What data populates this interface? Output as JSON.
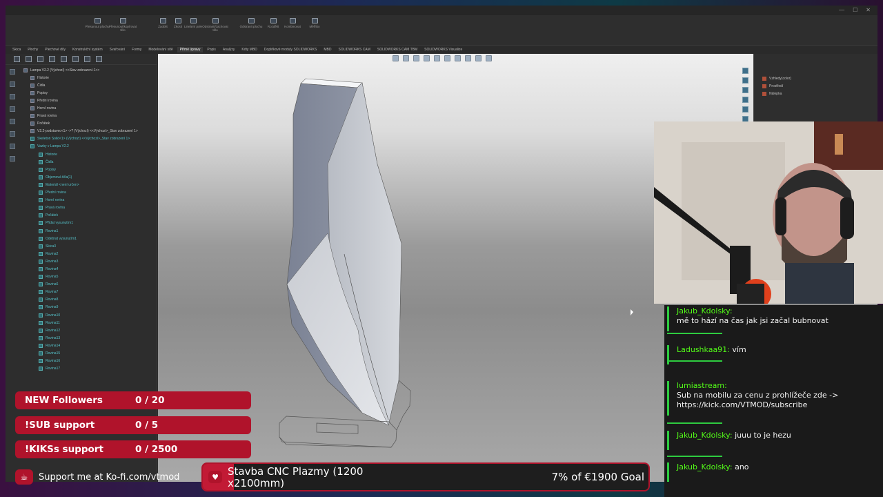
{
  "colors": {
    "accent": "#b0132b",
    "chat_name": "#53fc18",
    "chat_bar": "#2ecc40"
  },
  "ribbon": {
    "buttons": [
      {
        "label": "Přesunout plochu",
        "icon": "move-face-icon"
      },
      {
        "label": "Přesunout/kopírovat tělo",
        "icon": "move-body-icon"
      },
      {
        "label": "Zaoblit",
        "icon": "fillet-icon"
      },
      {
        "label": "Zkosit",
        "icon": "chamfer-icon"
      },
      {
        "label": "Lineární pole",
        "icon": "pattern-icon"
      },
      {
        "label": "Odstranit/zachovat tělo",
        "icon": "delete-body-icon"
      },
      {
        "label": "Odstranit plochu",
        "icon": "delete-face-icon"
      },
      {
        "label": "Rozdělit",
        "icon": "split-icon"
      },
      {
        "label": "Kombinovat",
        "icon": "combine-icon"
      },
      {
        "label": "Měřítko",
        "icon": "scale-icon"
      }
    ]
  },
  "tabs": [
    "Skica",
    "Plochy",
    "Plechové díly",
    "Konstrukční systém",
    "Svařování",
    "Formy",
    "Modelování sítě",
    "Přímé úpravy",
    "Popis",
    "Analýzy",
    "Kóty MBD",
    "Doplňkové moduly SOLIDWORKS",
    "MBD",
    "SOLIDWORKS CAM",
    "SOLIDWORKS CAM TBM",
    "SOLIDWORKS Visualize"
  ],
  "active_tab": "Přímé úpravy",
  "tree": [
    {
      "label": "Lampa V2.2 (Výchozí) <<Stav zobrazení-1>>",
      "teal": false
    },
    {
      "label": "Historie",
      "teal": false
    },
    {
      "label": "Čidla",
      "teal": false
    },
    {
      "label": "Popisy",
      "teal": false
    },
    {
      "label": "Přední rovina",
      "teal": false
    },
    {
      "label": "Horní rovina",
      "teal": false
    },
    {
      "label": "Pravá rovina",
      "teal": false
    },
    {
      "label": "Počátek",
      "teal": false
    },
    {
      "label": "V2.2-podstavec<1> ->? (Výchozí) <<Výchozí>_Stav zobrazení 1>",
      "teal": false
    },
    {
      "label": "Skeleton Solid<1> (Výchozí) <<Výchozí>_Stav zobrazení 1>",
      "teal": true
    },
    {
      "label": "Vazby v Lampa V2.2",
      "teal": true
    },
    {
      "label": "Historie",
      "teal": true
    },
    {
      "label": "Čidla",
      "teal": true
    },
    {
      "label": "Popisy",
      "teal": true
    },
    {
      "label": "Objemová těla(1)",
      "teal": true
    },
    {
      "label": "Materiál <není určen>",
      "teal": true
    },
    {
      "label": "Přední rovina",
      "teal": true
    },
    {
      "label": "Horní rovina",
      "teal": true
    },
    {
      "label": "Pravá rovina",
      "teal": true
    },
    {
      "label": "Počátek",
      "teal": true
    },
    {
      "label": "Přidat vysunutím1",
      "teal": true
    },
    {
      "label": "Rovina1",
      "teal": true
    },
    {
      "label": "Odebrat vysunutím1",
      "teal": true
    },
    {
      "label": "Skica3",
      "teal": true
    },
    {
      "label": "Rovina2",
      "teal": true
    },
    {
      "label": "Rovina3",
      "teal": true
    },
    {
      "label": "Rovina4",
      "teal": true
    },
    {
      "label": "Rovina5",
      "teal": true
    },
    {
      "label": "Rovina6",
      "teal": true
    },
    {
      "label": "Rovina7",
      "teal": true
    },
    {
      "label": "Rovina8",
      "teal": true
    },
    {
      "label": "Rovina9",
      "teal": true
    },
    {
      "label": "Rovina10",
      "teal": true
    },
    {
      "label": "Rovina11",
      "teal": true
    },
    {
      "label": "Rovina12",
      "teal": true
    },
    {
      "label": "Rovina13",
      "teal": true
    },
    {
      "label": "Rovina14",
      "teal": true
    },
    {
      "label": "Rovina15",
      "teal": true
    },
    {
      "label": "Rovina16",
      "teal": true
    },
    {
      "label": "Rovina17",
      "teal": true
    }
  ],
  "right_panel": [
    "Vzhledy(color)",
    "Prostředí",
    "Nálepka"
  ],
  "goals": [
    {
      "label": "NEW Followers",
      "value": "0 / 20"
    },
    {
      "label": "!SUB support",
      "value": "0 / 5"
    },
    {
      "label": "!KIKSs support",
      "value": "0 / 2500"
    }
  ],
  "kofi": {
    "text": "Support me at Ko-fi.com/vtmod",
    "icon": "kofi-cup-icon"
  },
  "goal_bar": {
    "title": "Stavba CNC Plazmy (1200 x2100mm)",
    "progress_text": "7% of €1900 Goal",
    "progress": 0.07
  },
  "chat": [
    {
      "name": "Jakub_Kdolsky:",
      "text": "mě to hází na čas jak jsi začal bubnovat"
    },
    {
      "name": "Ladushkaa91:",
      "text": "vím"
    },
    {
      "name": "lumiastream:",
      "text": "Sub na mobilu za cenu z prohlížeče zde -> https://kick.com/VTMOD/subscribe"
    },
    {
      "name": "Jakub_Kdolsky:",
      "text": "juuu to je hezu"
    },
    {
      "name": "Jakub_Kdolsky:",
      "text": "ano"
    }
  ]
}
